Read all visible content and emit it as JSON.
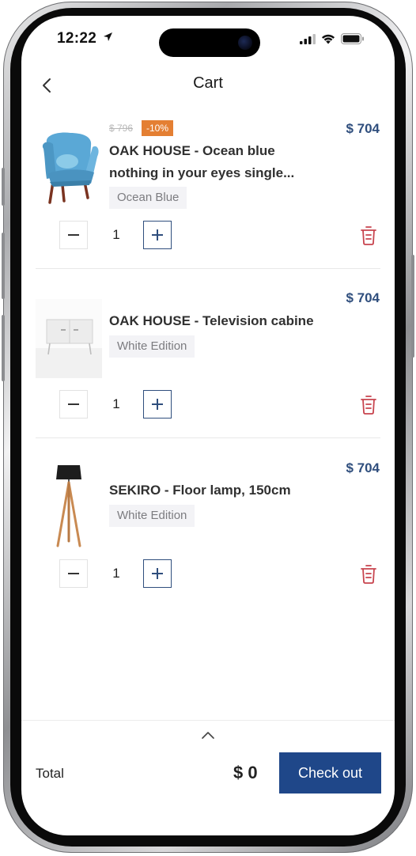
{
  "status_bar": {
    "time": "12:22"
  },
  "header": {
    "title": "Cart"
  },
  "items": [
    {
      "old_price": "$ 796",
      "discount": "-10%",
      "price": "$ 704",
      "name": "OAK HOUSE - Ocean blue nothing in your eyes single...",
      "variant": "Ocean Blue",
      "quantity": "1",
      "image_icon": "armchair-image"
    },
    {
      "price": "$ 704",
      "name": "OAK HOUSE - Television cabine",
      "variant": "White Edition",
      "quantity": "1",
      "image_icon": "tv-cabinet-image"
    },
    {
      "price": "$ 704",
      "name": "SEKIRO - Floor lamp, 150cm",
      "variant": "White Edition",
      "quantity": "1",
      "image_icon": "floor-lamp-image"
    }
  ],
  "footer": {
    "total_label": "Total",
    "total_value": "$ 0",
    "checkout_label": "Check out"
  },
  "colors": {
    "accent": "#1f4789",
    "price": "#2f4e7d",
    "discount": "#e47f33",
    "trash": "#c8444e"
  }
}
